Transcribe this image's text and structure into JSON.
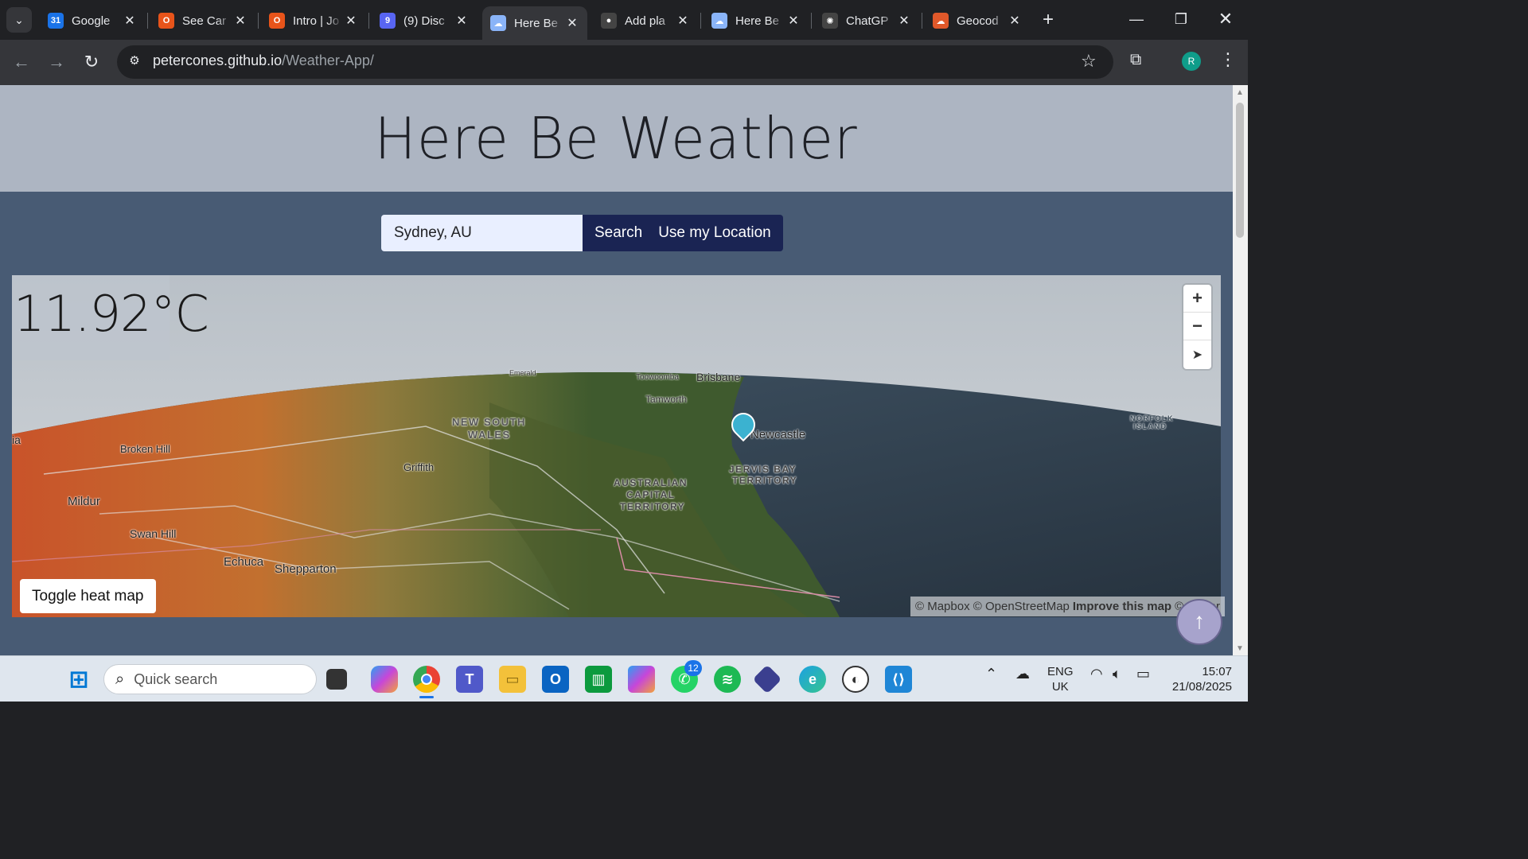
{
  "browser": {
    "tabs": [
      {
        "title": "Google",
        "icon": "google-calendar-icon",
        "color": "#1a73e8",
        "glyph": "31"
      },
      {
        "title": "See Car",
        "icon": "ring-icon",
        "color": "#e8541a",
        "glyph": "O"
      },
      {
        "title": "Intro | Jo",
        "icon": "ring-icon",
        "color": "#e8541a",
        "glyph": "O"
      },
      {
        "title": "(9) Disc",
        "icon": "discord-icon",
        "color": "#5865f2",
        "glyph": "9"
      },
      {
        "title": "Here Be",
        "icon": "weather-icon",
        "color": "#8ab4f8",
        "glyph": "☁"
      },
      {
        "title": "Add pla",
        "icon": "github-icon",
        "color": "#444",
        "glyph": "●"
      },
      {
        "title": "Here Be",
        "icon": "weather-icon",
        "color": "#8ab4f8",
        "glyph": "☁"
      },
      {
        "title": "ChatGP",
        "icon": "openai-icon",
        "color": "#444",
        "glyph": "✺"
      },
      {
        "title": "Geocod",
        "icon": "cloud-icon",
        "color": "#e0582a",
        "glyph": "☁"
      }
    ],
    "active_tab_index": 4,
    "url_host": "petercones.github.io",
    "url_path": "/Weather-App/",
    "profile_initial": "R"
  },
  "page": {
    "title": "Here Be Weather",
    "search_value": "Sydney, AU",
    "search_button": "Search",
    "location_button": "Use my Location",
    "temperature": "11.92°C",
    "toggle_heatmap": "Toggle heat map",
    "attribution": {
      "mapbox": "© Mapbox",
      "osm": "© OpenStreetMap",
      "improve": "Improve this map",
      "maxar": "© Maxar"
    },
    "map_labels": {
      "emerald": "Emerald",
      "toowoomba": "Toowoomba",
      "brisbane": "Brisbane",
      "tamworth": "Tamworth",
      "nsw_1": "NEW SOUTH",
      "nsw_2": "WALES",
      "newcastle": "Newcastle",
      "broken_hill": "Broken Hill",
      "griffith": "Griffith",
      "jervis_1": "JERVIS BAY",
      "jervis_2": "TERRITORY",
      "act_1": "AUSTRALIAN",
      "act_2": "CAPITAL",
      "act_3": "TERRITORY",
      "norfolk_1": "NORFOLK",
      "norfolk_2": "ISLAND",
      "mildura": "Mildur",
      "swan_hill": "Swan Hill",
      "echuca": "Echuca",
      "shepparton": "Shepparton",
      "edge": "ia"
    }
  },
  "taskbar": {
    "search_placeholder": "Quick search",
    "whatsapp_badge": "12",
    "lang_1": "ENG",
    "lang_2": "UK",
    "time": "15:07",
    "date": "21/08/2025"
  }
}
